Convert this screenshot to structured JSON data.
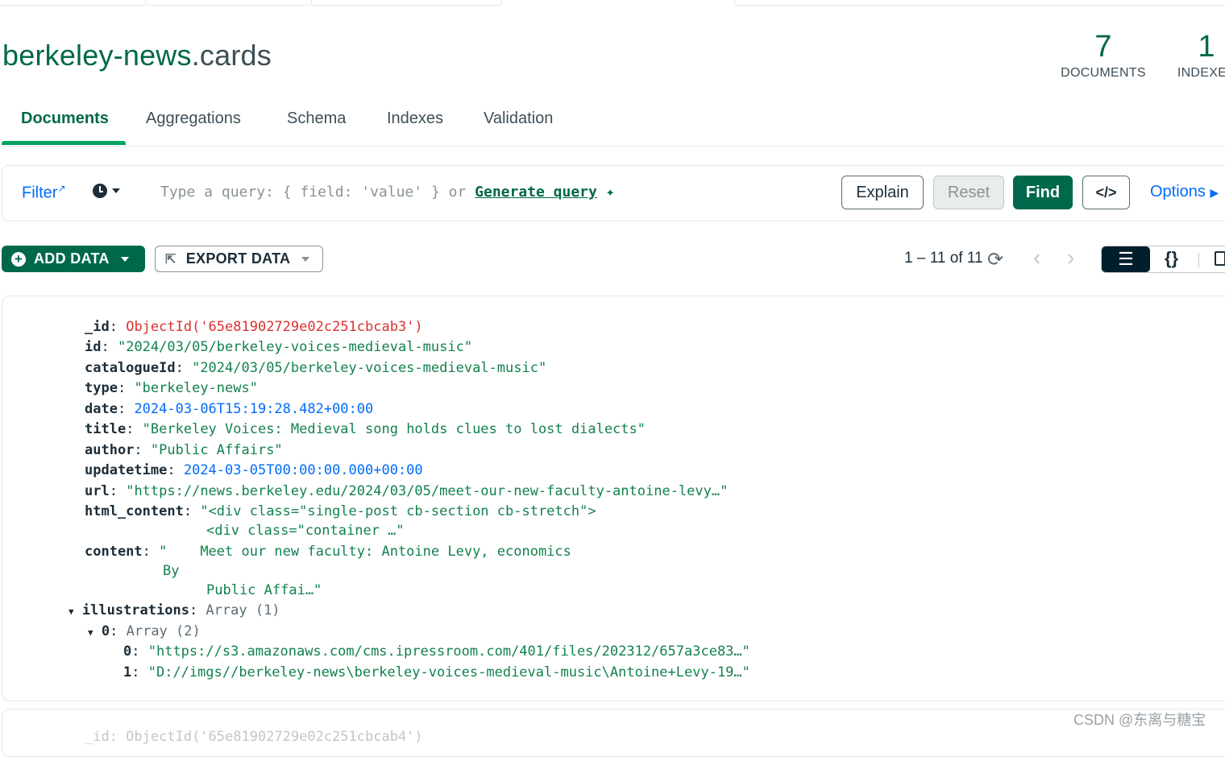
{
  "namespace": {
    "database": "berkeley-news",
    "collection": ".cards"
  },
  "stats": {
    "documents": {
      "value": "7",
      "label": "DOCUMENTS"
    },
    "indexes": {
      "value": "1",
      "label": "INDEXES"
    }
  },
  "tabs": [
    {
      "label": "Documents",
      "active": true
    },
    {
      "label": "Aggregations"
    },
    {
      "label": "Schema"
    },
    {
      "label": "Indexes"
    },
    {
      "label": "Validation"
    }
  ],
  "query_bar": {
    "filter_label": "Filter",
    "placeholder": "Type a query: { field: 'value' } or ",
    "generate_query": "Generate query",
    "explain": "Explain",
    "reset": "Reset",
    "find": "Find",
    "code_icon": "</>",
    "options": "Options"
  },
  "toolbar": {
    "add_data": "ADD DATA",
    "export_data": "EXPORT DATA",
    "pagination": "1 – 11 of 11"
  },
  "document": {
    "id_key": "_id",
    "id_value": "ObjectId('65e81902729e02c251cbcab3')",
    "id2_key": "id",
    "id2_value": "\"2024/03/05/berkeley-voices-medieval-music\"",
    "catalogue_key": "catalogueId",
    "catalogue_value": "\"2024/03/05/berkeley-voices-medieval-music\"",
    "type_key": "type",
    "type_value": "\"berkeley-news\"",
    "date_key": "date",
    "date_value": "2024-03-06T15:19:28.482+00:00",
    "title_key": "title",
    "title_value": "\"Berkeley Voices: Medieval song holds clues to lost dialects\"",
    "author_key": "author",
    "author_value": "\"Public Affairs\"",
    "updatetime_key": "updatetime",
    "updatetime_value": "2024-03-05T00:00:00.000+00:00",
    "url_key": "url",
    "url_value": "\"https://news.berkeley.edu/2024/03/05/meet-our-new-faculty-antoine-levy…\"",
    "html_key": "html_content",
    "html_value_1": "\"<div class=\"single-post cb-section cb-stretch\">",
    "html_value_2": "<div class=\"container …\"",
    "content_key": "content",
    "content_value_1": "\"    Meet our new faculty: Antoine Levy, economics",
    "content_value_2": "By",
    "content_value_3": "Public Affai…\"",
    "illustrations_key": "illustrations",
    "illustrations_type": "Array (1)",
    "item0_key": "0",
    "item0_type": "Array (2)",
    "sub0_key": "0",
    "sub0_value": "\"https://s3.amazonaws.com/cms.ipressroom.com/401/files/202312/657a3ce83…\"",
    "sub1_key": "1",
    "sub1_value": "\"D://imgs//berkeley-news\\berkeley-voices-medieval-music\\Antoine+Levy-19…\""
  },
  "next_doc_peek": "_id: ObjectId('65e81902729e02c251cbcab4')",
  "watermark": "CSDN @东离与糖宝",
  "colors": {
    "brand_green": "#00684a",
    "accent_green": "#00a35c",
    "link_blue": "#016bf8",
    "string_green": "#12824d",
    "objectid_red": "#db3030",
    "dark": "#001e2b"
  }
}
